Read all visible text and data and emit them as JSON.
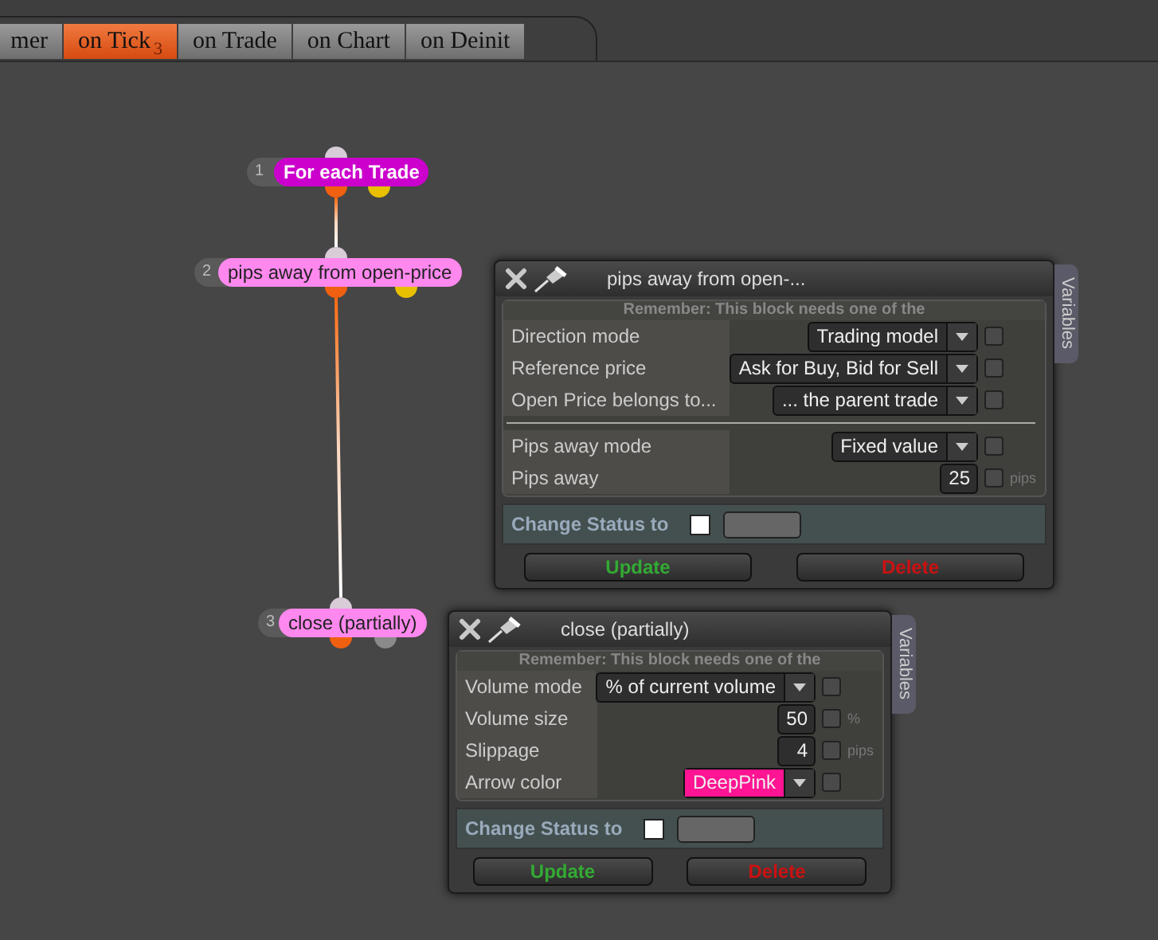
{
  "tabs": [
    {
      "label": "mer",
      "selected": false
    },
    {
      "label": "on Tick",
      "badge": "3",
      "selected": true
    },
    {
      "label": "on Trade",
      "selected": false
    },
    {
      "label": "on Chart",
      "selected": false
    },
    {
      "label": "on Deinit",
      "selected": false
    }
  ],
  "nodes": [
    {
      "number": "1",
      "label": "For each Trade",
      "kind": "loop",
      "color": "#cc00cc"
    },
    {
      "number": "2",
      "label": "pips away from open-price",
      "kind": "filter",
      "color": "#ff88ee"
    },
    {
      "number": "3",
      "label": "close (partially)",
      "kind": "action",
      "color": "#ff88ee"
    }
  ],
  "panels": [
    {
      "title": "pips away from open-...",
      "notice": "Remember: This block needs one of the",
      "side_tab": "Variables",
      "groups": [
        {
          "rows": [
            {
              "label": "Direction mode",
              "kind": "select",
              "value": "Trading model",
              "checked": false
            },
            {
              "label": "Reference price",
              "kind": "select",
              "value": "Ask for Buy, Bid for Sell",
              "checked": false
            },
            {
              "label": "Open Price belongs to...",
              "kind": "select",
              "value": "... the parent trade",
              "checked": false
            }
          ]
        },
        {
          "rows": [
            {
              "label": "Pips away mode",
              "kind": "select",
              "value": "Fixed value",
              "checked": false
            },
            {
              "label": "Pips away",
              "kind": "number",
              "value": "25",
              "unit": "pips",
              "checked": false
            }
          ]
        }
      ],
      "status_label": "Change Status to",
      "status_checked": false,
      "update": "Update",
      "delete": "Delete"
    },
    {
      "title": "close (partially)",
      "notice": "Remember: This block needs one of the",
      "side_tab": "Variables",
      "groups": [
        {
          "rows": [
            {
              "label": "Volume mode",
              "kind": "select",
              "value": "% of current volume",
              "checked": false
            },
            {
              "label": "Volume size",
              "kind": "number",
              "value": "50",
              "unit": "%",
              "checked": false
            },
            {
              "label": "Slippage",
              "kind": "number",
              "value": "4",
              "unit": "pips",
              "checked": false
            },
            {
              "label": "Arrow color",
              "kind": "select",
              "value": "DeepPink",
              "color": "#ff1493",
              "checked": false
            }
          ]
        }
      ],
      "status_label": "Change Status to",
      "status_checked": false,
      "update": "Update",
      "delete": "Delete"
    }
  ]
}
